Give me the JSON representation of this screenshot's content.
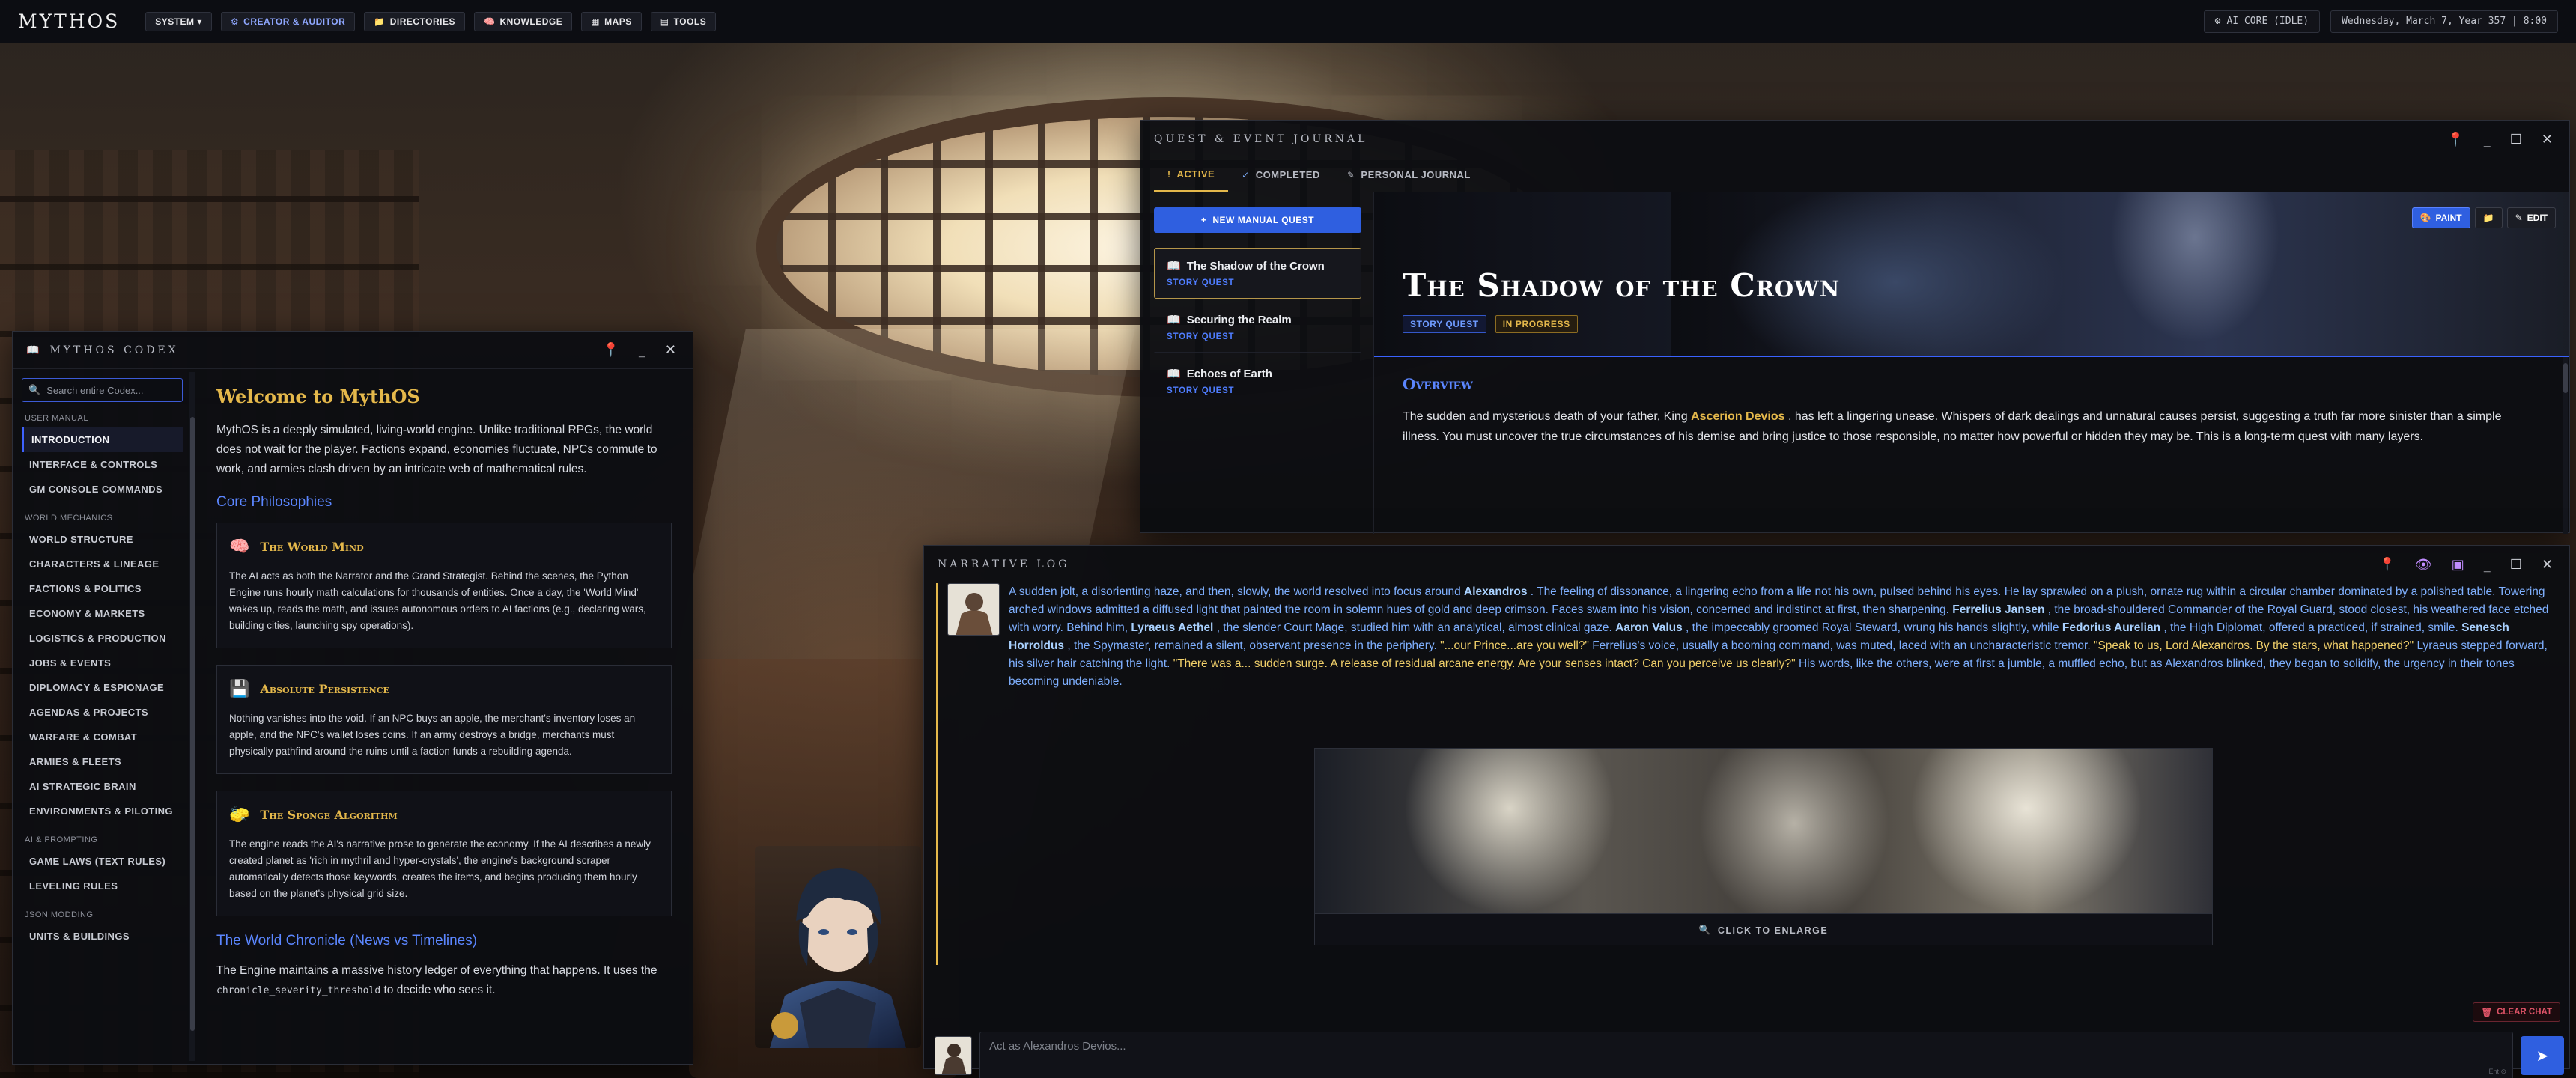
{
  "topbar": {
    "brand": "MYTHOS",
    "nav": [
      {
        "label": "SYSTEM ▾",
        "icon": ""
      },
      {
        "label": "CREATOR & AUDITOR",
        "icon": "⚙"
      },
      {
        "label": "DIRECTORIES",
        "icon": "📁"
      },
      {
        "label": "KNOWLEDGE",
        "icon": "🧠"
      },
      {
        "label": "MAPS",
        "icon": "▦"
      },
      {
        "label": "TOOLS",
        "icon": "▤"
      }
    ],
    "ai_core": "AI CORE (IDLE)",
    "date": "Wednesday, March 7, Year 357 | 8:00"
  },
  "codex": {
    "title": "MYTHOS CODEX",
    "search_placeholder": "Search entire Codex...",
    "categories": [
      {
        "head": "USER MANUAL",
        "items": [
          "INTRODUCTION",
          "INTERFACE & CONTROLS",
          "GM CONSOLE COMMANDS"
        ]
      },
      {
        "head": "WORLD MECHANICS",
        "items": [
          "WORLD STRUCTURE",
          "CHARACTERS & LINEAGE",
          "FACTIONS & POLITICS",
          "ECONOMY & MARKETS",
          "LOGISTICS & PRODUCTION",
          "JOBS & EVENTS",
          "DIPLOMACY & ESPIONAGE",
          "AGENDAS & PROJECTS",
          "WARFARE & COMBAT",
          "ARMIES & FLEETS",
          "AI STRATEGIC BRAIN",
          "ENVIRONMENTS & PILOTING"
        ]
      },
      {
        "head": "AI & PROMPTING",
        "items": [
          "GAME LAWS (TEXT RULES)",
          "LEVELING RULES"
        ]
      },
      {
        "head": "JSON MODDING",
        "items": [
          "UNITS & BUILDINGS"
        ]
      }
    ],
    "heading": "Welcome to MythOS",
    "intro": "MythOS is a deeply simulated, living-world engine. Unlike traditional RPGs, the world does not wait for the player. Factions expand, economies fluctuate, NPCs commute to work, and armies clash driven by an intricate web of mathematical rules.",
    "core_heading": "Core Philosophies",
    "cards": [
      {
        "icon": "🧠",
        "title": "The World Mind",
        "text": "The AI acts as both the Narrator and the Grand Strategist. Behind the scenes, the Python Engine runs hourly math calculations for thousands of entities. Once a day, the 'World Mind' wakes up, reads the math, and issues autonomous orders to AI factions (e.g., declaring wars, building cities, launching spy operations)."
      },
      {
        "icon": "💾",
        "title": "Absolute Persistence",
        "text": "Nothing vanishes into the void. If an NPC buys an apple, the merchant's inventory loses an apple, and the NPC's wallet loses coins. If an army destroys a bridge, merchants must physically pathfind around the ruins until a faction funds a rebuilding agenda."
      },
      {
        "icon": "🧽",
        "title": "The Sponge Algorithm",
        "text": "The engine reads the AI's narrative prose to generate the economy. If the AI describes a newly created planet as 'rich in mythril and hyper-crystals', the engine's background scraper automatically detects those keywords, creates the items, and begins producing them hourly based on the planet's physical grid size."
      }
    ],
    "chronicle_heading": "The World Chronicle (News vs Timelines)",
    "chronicle_pre": "The Engine maintains a massive history ledger of everything that happens. It uses the ",
    "chronicle_code": "chronicle_severity_threshold",
    "chronicle_post": " to decide who sees it."
  },
  "journal": {
    "title": "QUEST & EVENT JOURNAL",
    "tabs": [
      {
        "label": "ACTIVE",
        "icon": "!"
      },
      {
        "label": "COMPLETED",
        "icon": "✓"
      },
      {
        "label": "PERSONAL JOURNAL",
        "icon": "✎"
      }
    ],
    "new_quest": "NEW MANUAL QUEST",
    "quests": [
      {
        "name": "The Shadow of the Crown",
        "type": "STORY QUEST"
      },
      {
        "name": "Securing the Realm",
        "type": "STORY QUEST"
      },
      {
        "name": "Echoes of Earth",
        "type": "STORY QUEST"
      }
    ],
    "detail_title": "The Shadow of the Crown",
    "badge_type": "STORY QUEST",
    "badge_status": "IN PROGRESS",
    "actions": {
      "paint": "PAINT",
      "edit": "EDIT"
    },
    "overview_heading": "Overview",
    "overview_pre": "The sudden and mysterious death of your father, King ",
    "overview_name": "Ascerion Devios",
    "overview_post": " , has left a lingering unease. Whispers of dark dealings and unnatural causes persist, suggesting a truth far more sinister than a simple illness. You must uncover the true circumstances of his demise and bring justice to those responsible, no matter how powerful or hidden they may be. This is a long-term quest with many layers."
  },
  "narrative": {
    "title": "NARRATIVE LOG",
    "segments": [
      {
        "t": "A sudden jolt, a disorienting haze, and then, slowly, the world resolved into focus around ",
        "c": ""
      },
      {
        "t": " Alexandros ",
        "c": "nm"
      },
      {
        "t": ". The feeling of dissonance, a lingering echo from a life not his own, pulsed behind his eyes. He lay sprawled on a plush, ornate rug within a circular chamber dominated by a polished table. Towering arched windows admitted a diffused light that painted the room in solemn hues of gold and deep crimson. Faces swam into his vision, concerned and indistinct at first, then sharpening. ",
        "c": ""
      },
      {
        "t": " Ferrelius Jansen ",
        "c": "nm"
      },
      {
        "t": ", the broad-shouldered Commander of the Royal Guard, stood closest, his weathered face etched with worry. Behind him, ",
        "c": ""
      },
      {
        "t": " Lyraeus Aethel ",
        "c": "nm"
      },
      {
        "t": ", the slender Court Mage, studied him with an analytical, almost clinical gaze. ",
        "c": ""
      },
      {
        "t": " Aaron Valus ",
        "c": "nm"
      },
      {
        "t": ", the impeccably groomed Royal Steward, wrung his hands slightly, while ",
        "c": ""
      },
      {
        "t": " Fedorius  Aurelian ",
        "c": "nm"
      },
      {
        "t": ", the High Diplomat, offered a practiced, if strained, smile. ",
        "c": ""
      },
      {
        "t": " Senesch Horroldus ",
        "c": "nm"
      },
      {
        "t": ", the Spymaster, remained a silent, observant presence in the periphery. ",
        "c": ""
      },
      {
        "t": "\"...our Prince...are you well?\"",
        "c": "sp"
      },
      {
        "t": " Ferrelius's voice, usually a booming command, was muted, laced with an uncharacteristic tremor. ",
        "c": ""
      },
      {
        "t": "\"Speak to us, Lord Alexandros. By the stars, what happened?\"",
        "c": "sp"
      },
      {
        "t": " Lyraeus stepped forward, his silver hair catching the light. ",
        "c": ""
      },
      {
        "t": "\"There was a... sudden surge. A release of residual arcane energy. Are your senses intact? Can you perceive us clearly?\"",
        "c": "sp"
      },
      {
        "t": " His words, like the others, were at first a jumble, a muffled echo, but as Alexandros blinked, they began to solidify, the urgency in their tones becoming undeniable.",
        "c": ""
      }
    ],
    "enlarge": "CLICK TO ENLARGE",
    "clear_chat": "CLEAR CHAT",
    "input_placeholder": "Act as Alexandros Devios...",
    "input_hint": "Ent ⊙"
  },
  "colors": {
    "accent_blue": "#2f5fe0",
    "gold": "#e4b84b",
    "danger": "#e05468"
  }
}
